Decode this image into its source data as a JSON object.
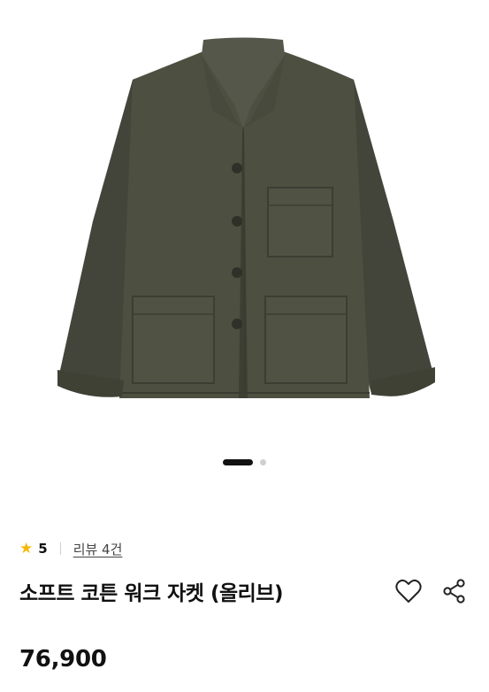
{
  "product": {
    "image_alt": "olive work jacket",
    "rating": "5",
    "review_link": "리뷰 4건",
    "title": "소프트 코튼 워크 자켓 (올리브)",
    "price": "76,900"
  },
  "gallery": {
    "current_slide": 1,
    "total_slides": 2
  },
  "icons": {
    "rating": "star-icon",
    "wishlist": "heart-icon",
    "share": "share-icon"
  },
  "colors": {
    "star": "#f5b800",
    "jacket": "#4a4c3d",
    "active_dot": "#111111",
    "inactive_dot": "#cfcfcf"
  }
}
